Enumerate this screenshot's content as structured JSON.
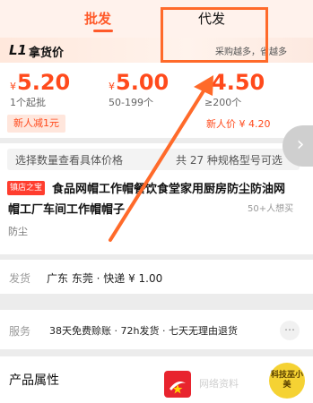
{
  "tabs": {
    "wholesale": "批发",
    "dropship": "代发"
  },
  "tier": {
    "badge": "L1",
    "label": "拿货价",
    "promo_tip": "采购越多，省越多"
  },
  "prices": [
    {
      "currency": "¥",
      "amount": "5.20",
      "qty": "1个起批"
    },
    {
      "currency": "¥",
      "amount": "5.00",
      "qty": "50-199个"
    },
    {
      "currency": "¥",
      "amount": "4.50",
      "qty": "≥200个"
    }
  ],
  "coupon": {
    "label": "新人减1元",
    "new_user_price": "新人价 ¥ 4.20"
  },
  "sku": {
    "hint": "选择数量查看具体价格",
    "count": "共 27 种规格型号可选",
    "arrow": "›"
  },
  "product": {
    "store_badge": "镇店之宝",
    "title_line1": "食品网帽工作帽餐饮食堂家用厨房防尘防油网",
    "title_line2": "帽工厂车间工作帽帽子",
    "want_count": "50+人想买",
    "tag": "防尘"
  },
  "shipping": {
    "label": "发货",
    "value": "广东 东莞 · 快递 ¥ 1.00"
  },
  "service": {
    "label": "服务",
    "value": "38天免费赊账 · 72h发货 · 七天无理由退货",
    "more": "⋯"
  },
  "attributes": {
    "title": "产品属性"
  },
  "watermark": "网络资料",
  "avatar_text": "科技巫小美",
  "colors": {
    "accent": "#ff5a2a",
    "price": "#ff4a1c",
    "annotation": "#ff6a2a"
  }
}
